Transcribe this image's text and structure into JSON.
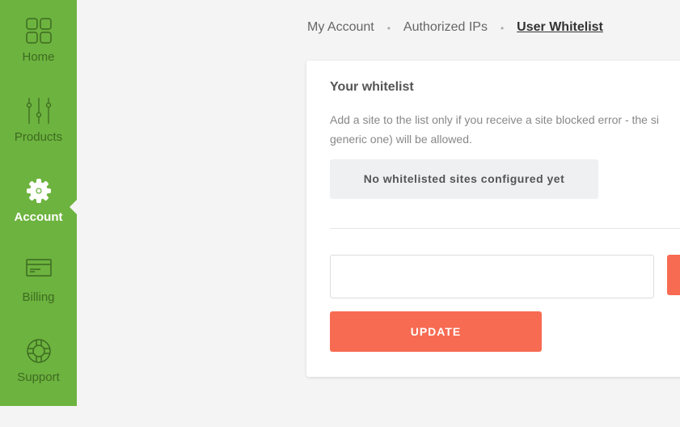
{
  "sidebar": {
    "items": [
      {
        "label": "Home",
        "icon": "grid-icon"
      },
      {
        "label": "Products",
        "icon": "sliders-icon"
      },
      {
        "label": "Account",
        "icon": "gear-icon",
        "active": true
      },
      {
        "label": "Billing",
        "icon": "credit-card-icon"
      },
      {
        "label": "Support",
        "icon": "lifebuoy-icon"
      }
    ]
  },
  "breadcrumb": {
    "items": [
      "My Account",
      "Authorized IPs",
      "User Whitelist"
    ],
    "separator": "•"
  },
  "card": {
    "title": "Your whitelist",
    "desc_line1": "Add a site to the list only if you receive a site blocked error - the si",
    "desc_line2": "generic one) will be allowed.",
    "empty_message": "No whitelisted sites configured yet",
    "input_value": "",
    "update_label": "UPDATE"
  },
  "colors": {
    "sidebar": "#6db33f",
    "accent": "#f76b52"
  }
}
